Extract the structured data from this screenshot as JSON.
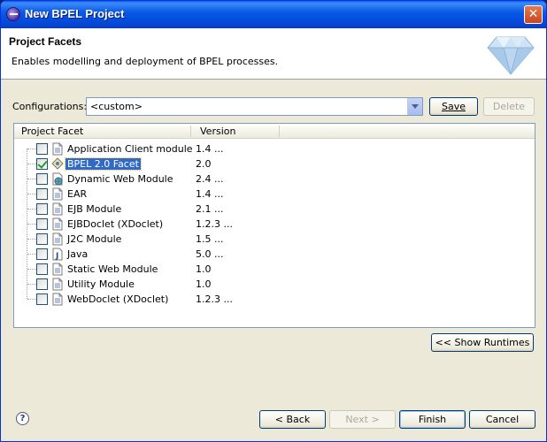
{
  "window": {
    "title": "New BPEL Project",
    "close_glyph": "✕"
  },
  "header": {
    "title": "Project Facets",
    "description": "Enables modelling and deployment of BPEL processes."
  },
  "configurations": {
    "label": "Configurations:",
    "value": "<custom>",
    "save_label": "Save",
    "delete_label": "Delete"
  },
  "table": {
    "col_facet": "Project Facet",
    "col_version": "Version",
    "rows": [
      {
        "name": "Application Client module",
        "version": "1.4 ...",
        "checked": false,
        "icon": "document-icon"
      },
      {
        "name": "BPEL 2.0 Facet",
        "version": "2.0",
        "checked": true,
        "icon": "bpel-icon"
      },
      {
        "name": "Dynamic Web Module",
        "version": "2.4 ...",
        "checked": false,
        "icon": "globe-document-icon"
      },
      {
        "name": "EAR",
        "version": "1.4 ...",
        "checked": false,
        "icon": "document-icon"
      },
      {
        "name": "EJB Module",
        "version": "2.1 ...",
        "checked": false,
        "icon": "document-icon"
      },
      {
        "name": "EJBDoclet (XDoclet)",
        "version": "1.2.3 ...",
        "checked": false,
        "icon": "document-icon"
      },
      {
        "name": "J2C Module",
        "version": "1.5 ...",
        "checked": false,
        "icon": "document-icon"
      },
      {
        "name": "Java",
        "version": "5.0 ...",
        "checked": false,
        "icon": "java-icon"
      },
      {
        "name": "Static Web Module",
        "version": "1.0",
        "checked": false,
        "icon": "document-icon"
      },
      {
        "name": "Utility Module",
        "version": "1.0",
        "checked": false,
        "icon": "document-icon"
      },
      {
        "name": "WebDoclet (XDoclet)",
        "version": "1.2.3 ...",
        "checked": false,
        "icon": "document-icon"
      }
    ]
  },
  "show_runtimes_label": "<< Show Runtimes",
  "footer": {
    "help_glyph": "?",
    "back_label": "< Back",
    "next_label": "Next >",
    "finish_label": "Finish",
    "cancel_label": "Cancel"
  }
}
